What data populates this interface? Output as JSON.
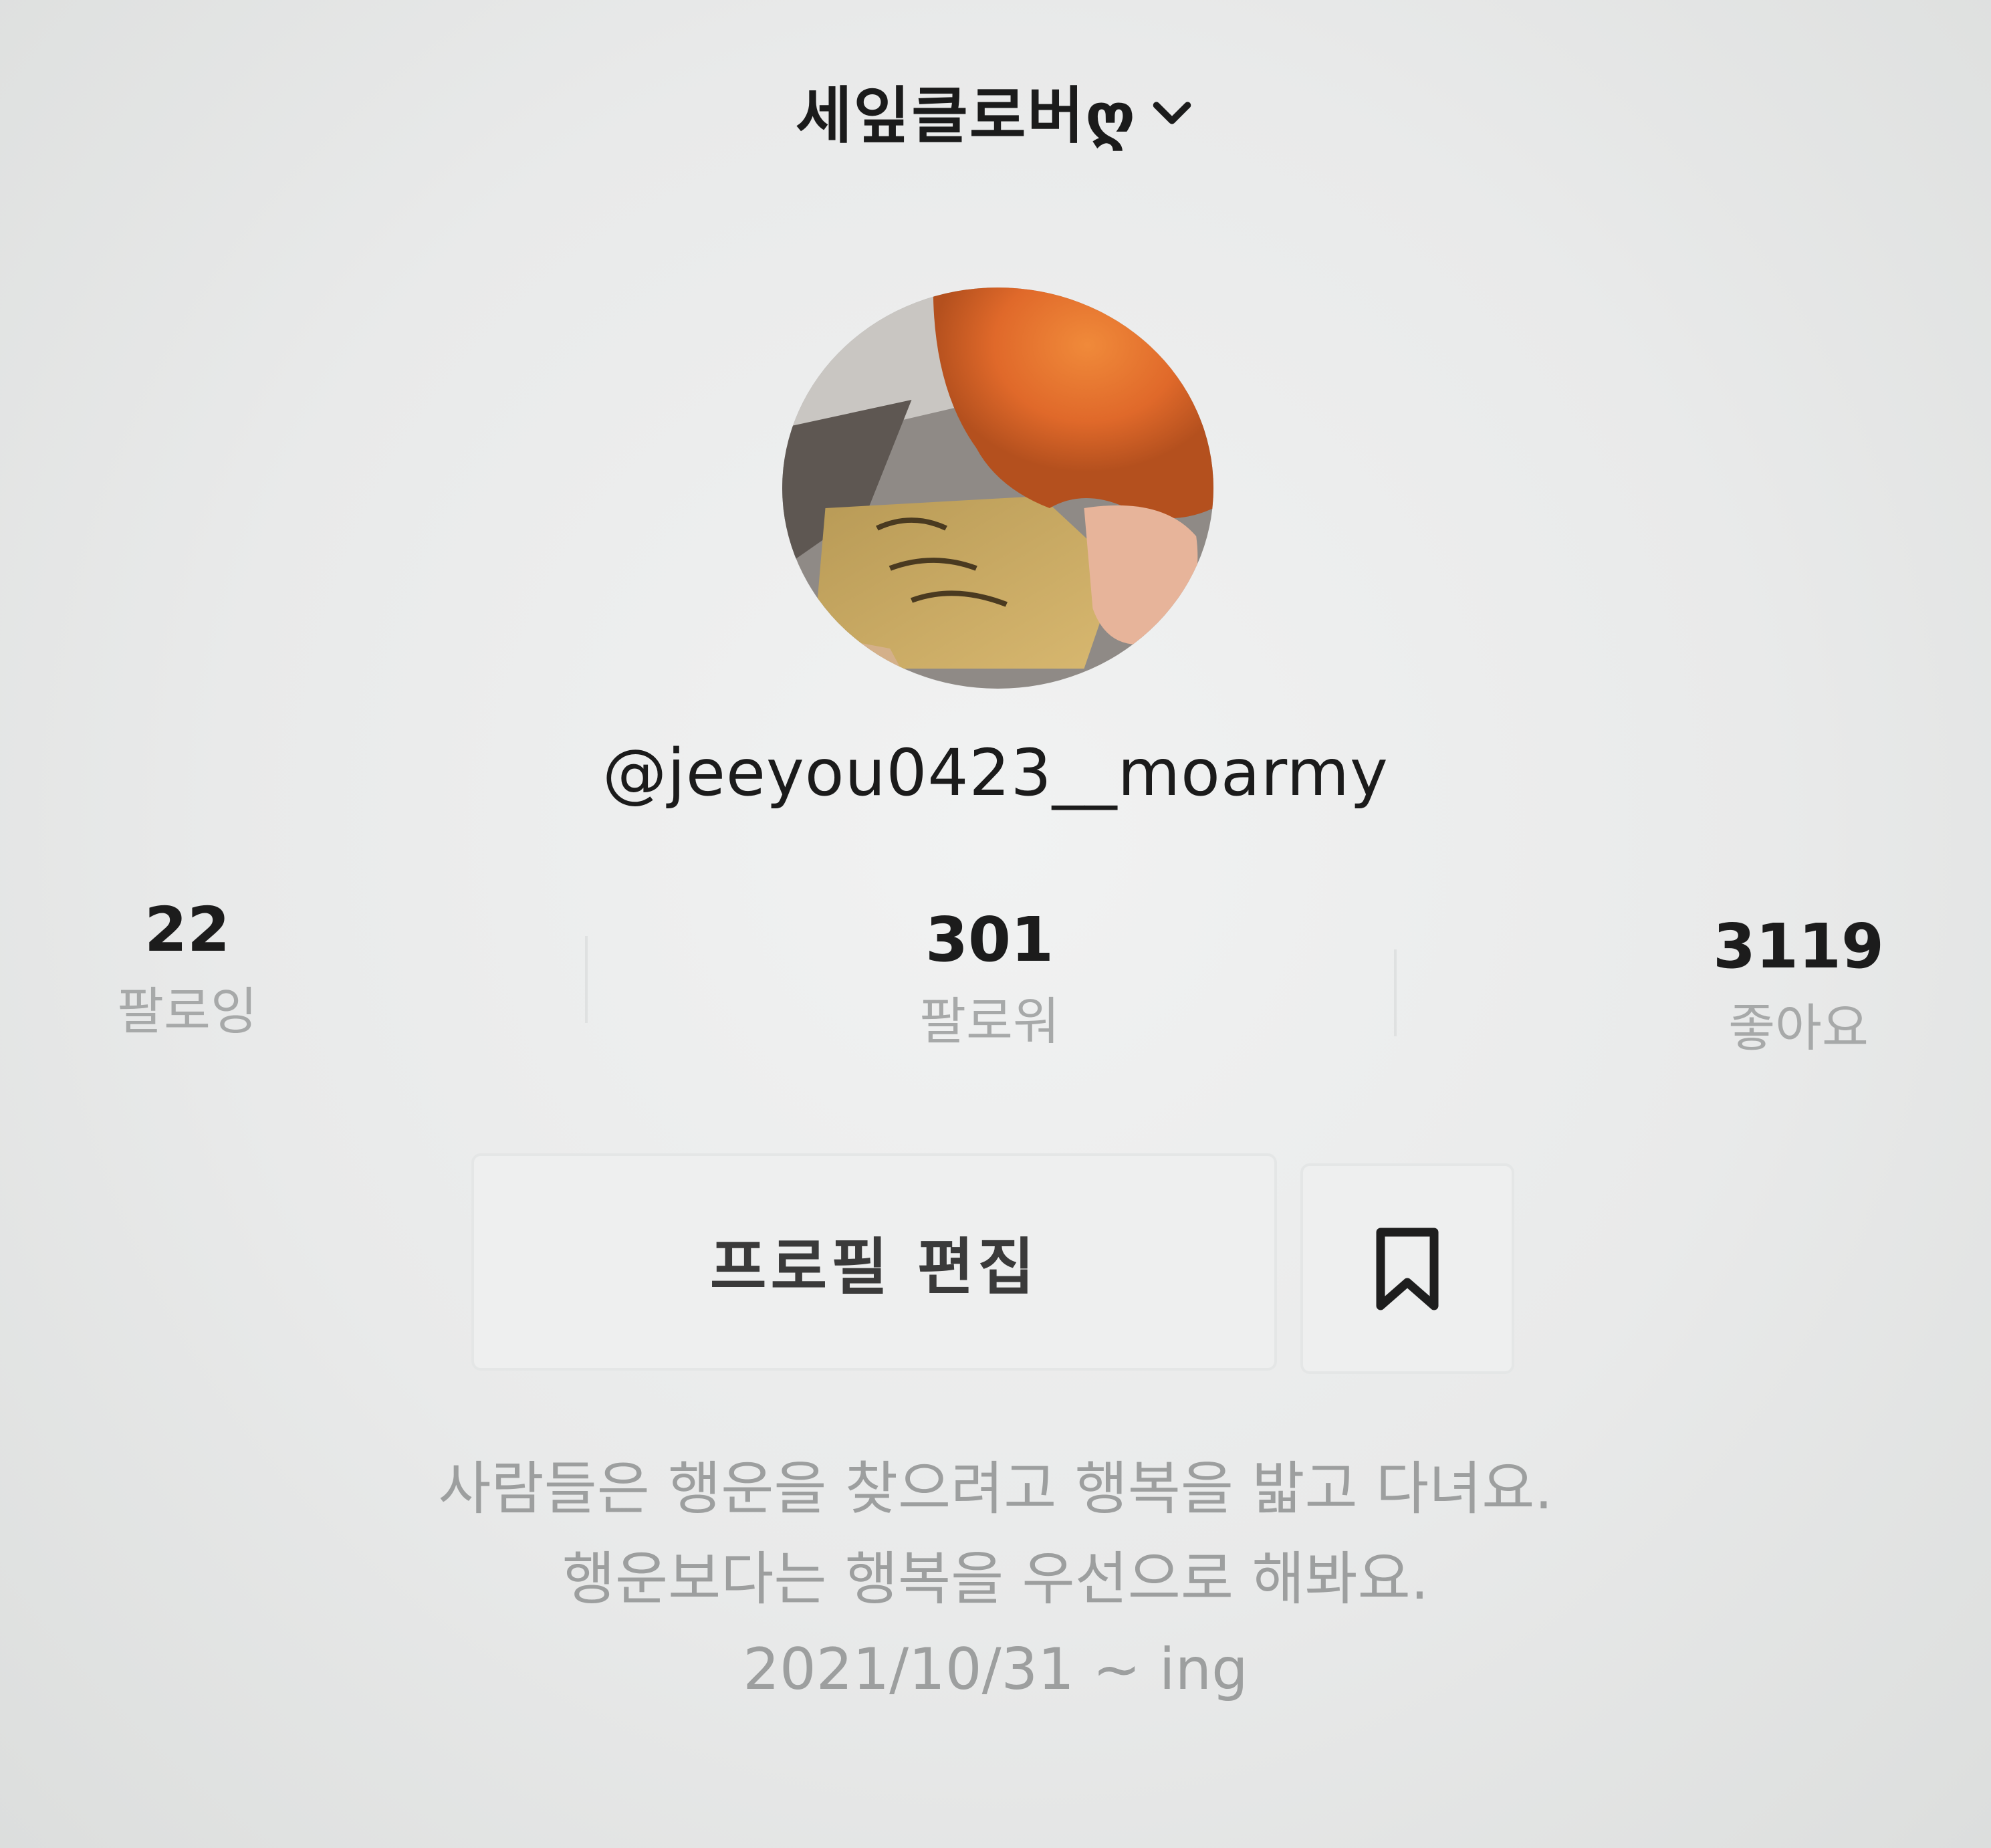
{
  "header": {
    "account_name": "세잎클로버ღ",
    "switch_icon": "chevron-down-icon"
  },
  "profile": {
    "avatar_icon": "profile-photo",
    "handle": "@jeeyou0423__moarmy"
  },
  "stats": {
    "following": {
      "value": "22",
      "label": "팔로잉"
    },
    "followers": {
      "value": "301",
      "label": "팔로워"
    },
    "likes": {
      "value": "3119",
      "label": "좋아요"
    }
  },
  "actions": {
    "edit_profile_label": "프로필 편집",
    "bookmark_icon": "bookmark-icon"
  },
  "bio": {
    "line1": "사람들은 행운을 찾으려고 행복을 밟고 다녀요.",
    "line2": "행운보다는 행복을 우선으로 해봐요.",
    "line3": "2021/10/31 ~ ing"
  },
  "colors": {
    "background": "#eceded",
    "primary_text": "#1c1c1c",
    "secondary_text": "#a7a9a9",
    "button_border": "#e4e6e6"
  }
}
